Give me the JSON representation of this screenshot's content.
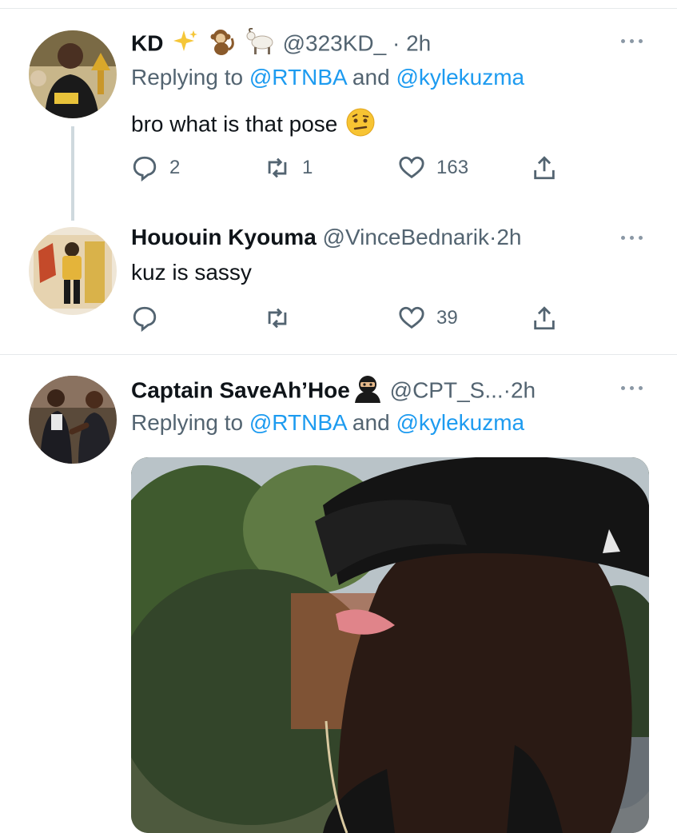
{
  "tweets": [
    {
      "name": "KD",
      "handle": "@323KD_",
      "dot": "·",
      "time": "2h",
      "replying_prefix": "Replying to ",
      "replying_mention_1": "@RTNBA",
      "replying_and": " and ",
      "replying_mention_2": "@kylekuzma",
      "text": "bro what is that pose",
      "replies": "2",
      "retweets": "1",
      "likes": "163"
    },
    {
      "name": "Hououin Kyouma",
      "handle": "@VinceBednarik",
      "dot": "·",
      "time": "2h",
      "text": "kuz is sassy",
      "replies": "",
      "retweets": "",
      "likes": "39"
    },
    {
      "name": "Captain SaveAh’Hoe",
      "handle": "@CPT_S...",
      "dot": "·",
      "time": "2h",
      "replying_prefix": "Replying to ",
      "replying_mention_1": "@RTNBA",
      "replying_and": " and ",
      "replying_mention_2": "@kylekuzma"
    }
  ],
  "icons": {
    "reply": "reply-icon",
    "retweet": "retweet-icon",
    "like": "heart-icon",
    "share": "share-icon",
    "more": "more-options-icon"
  },
  "colors": {
    "accent": "#1d9bf0",
    "secondary_text": "#536471",
    "divider": "#e6e9eb",
    "thread_line": "#cfd9de"
  }
}
